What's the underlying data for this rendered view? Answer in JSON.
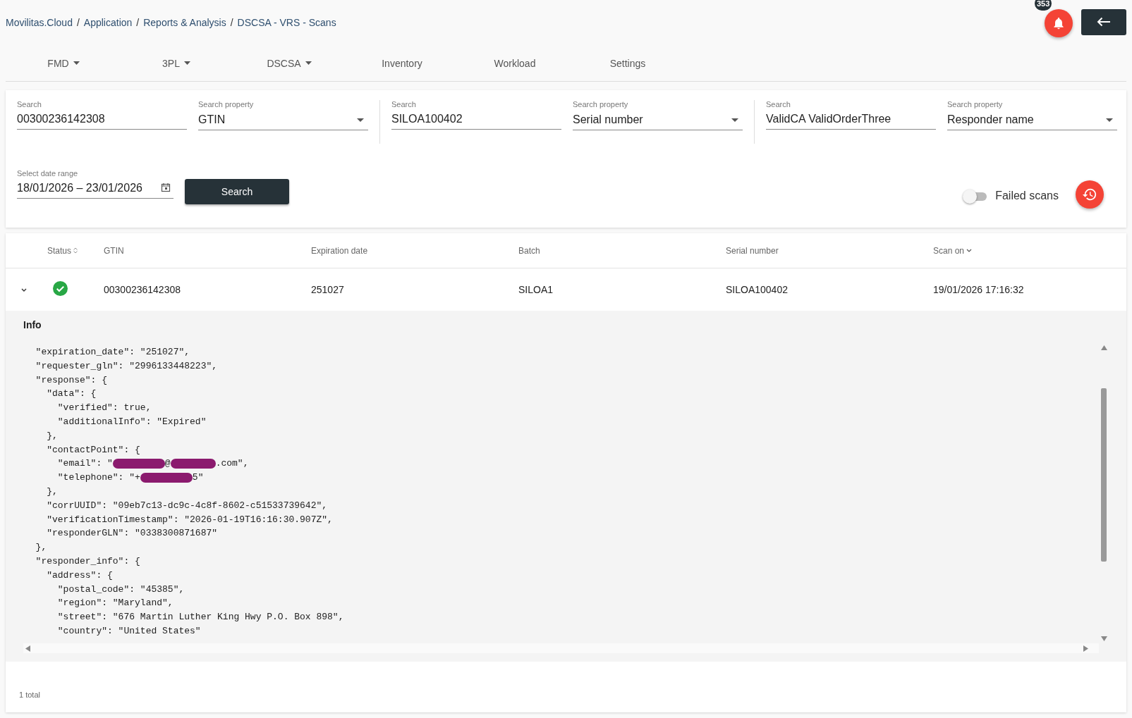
{
  "breadcrumb": {
    "items": [
      "Movilitas.Cloud",
      "Application",
      "Reports & Analysis",
      "DSCSA - VRS - Scans"
    ],
    "separator": "/"
  },
  "notifications": {
    "count": "353"
  },
  "nav_tabs": [
    {
      "label": "FMD",
      "dropdown": true,
      "selected": false
    },
    {
      "label": "3PL",
      "dropdown": true,
      "selected": false
    },
    {
      "label": "DSCSA",
      "dropdown": true,
      "selected": false
    },
    {
      "label": "Inventory",
      "dropdown": false,
      "selected": false
    },
    {
      "label": "Workload",
      "dropdown": false,
      "selected": false
    },
    {
      "label": "Settings",
      "dropdown": false,
      "selected": false
    }
  ],
  "filters": [
    {
      "search": {
        "label": "Search",
        "value": "00300236142308"
      },
      "property": {
        "label": "Search property",
        "value": "GTIN"
      }
    },
    {
      "search": {
        "label": "Search",
        "value": "SILOA100402"
      },
      "property": {
        "label": "Search property",
        "value": "Serial number"
      }
    },
    {
      "search": {
        "label": "Search",
        "value": "ValidCA ValidOrderThree"
      },
      "property": {
        "label": "Search property",
        "value": "Responder name"
      }
    }
  ],
  "date_range": {
    "label": "Select date range",
    "value": "18/01/2026 – 23/01/2026"
  },
  "search_button": "Search",
  "failed_scans": {
    "label": "Failed scans",
    "on": false
  },
  "table": {
    "columns": [
      {
        "label": "Status",
        "sortable": true,
        "sorted": false
      },
      {
        "label": "GTIN",
        "sortable": false
      },
      {
        "label": "Expiration date",
        "sortable": false
      },
      {
        "label": "Batch",
        "sortable": false
      },
      {
        "label": "Serial number",
        "sortable": false
      },
      {
        "label": "Scan on",
        "sortable": true,
        "sorted": true
      }
    ],
    "rows": [
      {
        "expanded": true,
        "valid": true,
        "cells": [
          "",
          "00300236142308",
          "251027",
          "SILOA1",
          "SILOA100402",
          "19/01/2026 17:16:32"
        ],
        "details": {
          "title": "Info",
          "lines": [
            "  \"expiration_date\": \"251027\",",
            "  \"requester_gln\": \"2996133448223\",",
            "  \"response\": {",
            "    \"data\": {",
            "      \"verified\": true,",
            "      \"additionalInfo\": \"Expired\"",
            "    },",
            "    \"contactPoint\": {",
            {
              "parts": [
                {
                  "kind": "text",
                  "text": "      \"email\": \""
                },
                {
                  "kind": "redacted"
                },
                {
                  "kind": "text",
                  "text": "@"
                },
                {
                  "kind": "redacted"
                },
                {
                  "kind": "text",
                  "text": ".com\","
                }
              ]
            },
            {
              "parts": [
                {
                  "kind": "text",
                  "text": "      \"telephone\": \"+"
                },
                {
                  "kind": "redacted"
                },
                {
                  "kind": "text",
                  "text": "5\""
                }
              ]
            },
            "    },",
            "    \"corrUUID\": \"09eb7c13-dc9c-4c8f-8602-c51533739642\",",
            "    \"verificationTimestamp\": \"2026-01-19T16:16:30.907Z\",",
            "    \"responderGLN\": \"0338300871687\"",
            "  },",
            "  \"responder_info\": {",
            "    \"address\": {",
            "      \"postal_code\": \"45385\",",
            "      \"region\": \"Maryland\",",
            "      \"street\": \"676 Martin Luther King Hwy P.O. Box 898\",",
            "      \"country\": \"United States\""
          ]
        }
      }
    ]
  },
  "footer": "1 total"
}
